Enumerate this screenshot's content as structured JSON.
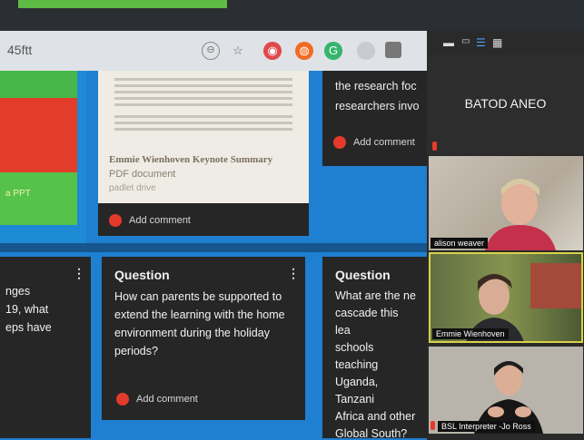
{
  "browser": {
    "url": "45ftt",
    "toolbar_icons": [
      "zoom-icon",
      "star-icon",
      "extension-red-icon",
      "extension-orange-icon",
      "extension-green-icon",
      "extension-gray-icon",
      "extension-white-icon"
    ]
  },
  "board": {
    "left_card_label": "a PPT",
    "doc_card": {
      "title": "Emmie Wienhoven Keynote Summary",
      "type": "PDF document",
      "source": "padlet drive",
      "comment": "Add comment"
    },
    "top_right_card": {
      "lines": [
        "the research foc",
        "researchers invo"
      ],
      "comment": "Add comment"
    },
    "bottom_left_card": {
      "lines": [
        "nges",
        "19, what",
        "eps have"
      ]
    },
    "question_card": {
      "title": "Question",
      "body": "How can parents be supported to extend the learning with the home environment during the holiday periods?",
      "comment": "Add comment"
    },
    "question_card_2": {
      "title": "Question",
      "lines": [
        "What are the ne",
        "cascade this lea",
        "schools teaching",
        "Uganda, Tanzani",
        "Africa and other",
        "Global South?"
      ]
    }
  },
  "video": {
    "banner_name": "BATOD ANEO",
    "participants": [
      "alison weaver",
      "Emmie Wienhoven",
      "BSL Interpreter -Jo Ross"
    ]
  },
  "colors": {
    "canvas": "#1f7fd0",
    "accent_red": "#e33a2c"
  }
}
